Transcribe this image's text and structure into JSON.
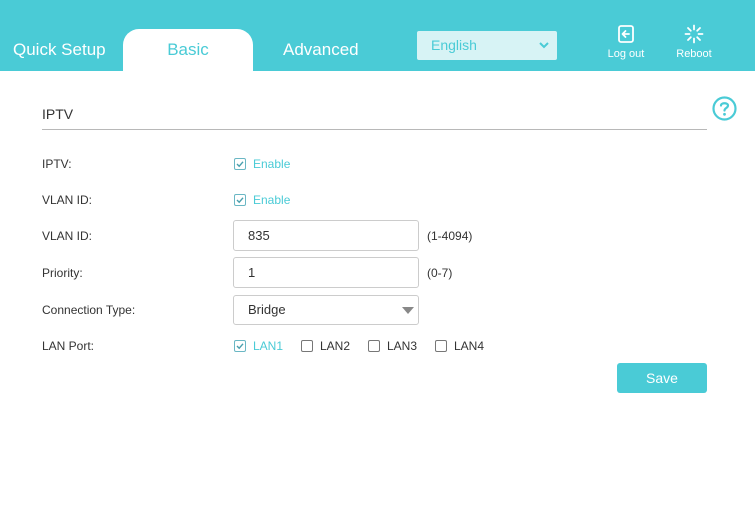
{
  "nav": {
    "tabs": [
      "Quick Setup",
      "Basic",
      "Advanced"
    ],
    "active_tab": "Basic",
    "language": "English",
    "logout_label": "Log out",
    "reboot_label": "Reboot"
  },
  "section": {
    "title": "IPTV"
  },
  "form": {
    "iptv": {
      "label": "IPTV:",
      "checkbox_label": "Enable",
      "checked": true
    },
    "vlan_enable": {
      "label": "VLAN ID:",
      "checkbox_label": "Enable",
      "checked": true
    },
    "vlan_id": {
      "label": "VLAN ID:",
      "value": "835",
      "hint": "(1-4094)"
    },
    "priority": {
      "label": "Priority:",
      "value": "1",
      "hint": "(0-7)"
    },
    "connection_type": {
      "label": "Connection Type:",
      "value": "Bridge"
    },
    "lan_port": {
      "label": "LAN Port:",
      "ports": [
        {
          "name": "LAN1",
          "checked": true
        },
        {
          "name": "LAN2",
          "checked": false
        },
        {
          "name": "LAN3",
          "checked": false
        },
        {
          "name": "LAN4",
          "checked": false
        }
      ]
    }
  },
  "save_label": "Save",
  "colors": {
    "accent": "#4acbd6",
    "accent_light": "#d7f3f5",
    "text": "#333333",
    "border": "#cccccc"
  },
  "icons": {
    "logout": "logout-icon",
    "reboot": "reboot-icon",
    "help": "help-icon",
    "language_dropdown": "chevron-down-icon"
  }
}
